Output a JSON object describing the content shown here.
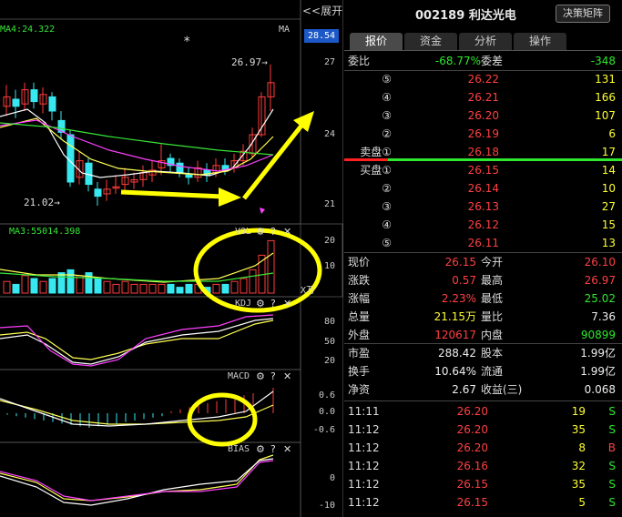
{
  "chart": {
    "expand_label": "<<展开",
    "ma_label": "MA4:24.322",
    "ma_right": "MA",
    "price_box": "28.54",
    "star": "*",
    "y_axis": [
      "27",
      "24",
      "21"
    ],
    "high_annotation": "26.97",
    "low_annotation": "21.02",
    "vol_ma": "MA3:55014.398",
    "vol_title": "VOL",
    "vol_axis": [
      "20",
      "10"
    ],
    "vol_unit": "X万",
    "kdj_title": "KDJ",
    "kdj_axis": [
      "80",
      "50",
      "20"
    ],
    "macd_title": "MACD",
    "macd_axis": [
      "0.6",
      "0.0",
      "-0.6"
    ],
    "bias_title": "BIAS",
    "bias_axis": [
      "0",
      "-10"
    ]
  },
  "header": {
    "code": "002189",
    "name": "利达光电",
    "decision_button": "决策矩阵"
  },
  "tabs": [
    "报价",
    "资金",
    "分析",
    "操作"
  ],
  "weibi": {
    "label": "委比",
    "value": "-68.77%",
    "diff_label": "委差",
    "diff_value": "-348"
  },
  "sell_orders": [
    {
      "label": "⑤",
      "price": "26.22",
      "volume": "131"
    },
    {
      "label": "④",
      "price": "26.21",
      "volume": "166"
    },
    {
      "label": "③",
      "price": "26.20",
      "volume": "107"
    },
    {
      "label": "②",
      "price": "26.19",
      "volume": "6"
    },
    {
      "label": "卖盘①",
      "price": "26.18",
      "volume": "17"
    }
  ],
  "buy_orders": [
    {
      "label": "买盘①",
      "price": "26.15",
      "volume": "14"
    },
    {
      "label": "②",
      "price": "26.14",
      "volume": "10"
    },
    {
      "label": "③",
      "price": "26.13",
      "volume": "27"
    },
    {
      "label": "④",
      "price": "26.12",
      "volume": "15"
    },
    {
      "label": "⑤",
      "price": "26.11",
      "volume": "13"
    }
  ],
  "stats": [
    {
      "l1": "现价",
      "v1": "26.15",
      "l2": "今开",
      "v2": "26.10"
    },
    {
      "l1": "涨跌",
      "v1": "0.57",
      "l2": "最高",
      "v2": "26.97"
    },
    {
      "l1": "涨幅",
      "v1": "2.23%",
      "l2": "最低",
      "v2": "25.02"
    },
    {
      "l1": "总量",
      "v1": "21.15万",
      "l2": "量比",
      "v2": "7.36"
    },
    {
      "l1": "外盘",
      "v1": "120617",
      "l2": "内盘",
      "v2": "90899"
    }
  ],
  "fundamentals": [
    {
      "l1": "市盈",
      "v1": "288.42",
      "l2": "股本",
      "v2": "1.99亿"
    },
    {
      "l1": "换手",
      "v1": "10.64%",
      "l2": "流通",
      "v2": "1.99亿"
    },
    {
      "l1": "净资",
      "v1": "2.67",
      "l2": "收益(三)",
      "v2": "0.068"
    }
  ],
  "trades": [
    {
      "time": "11:11",
      "price": "26.20",
      "volume": "19",
      "side": "S"
    },
    {
      "time": "11:12",
      "price": "26.20",
      "volume": "35",
      "side": "S"
    },
    {
      "time": "11:12",
      "price": "26.20",
      "volume": "8",
      "side": "B"
    },
    {
      "time": "11:12",
      "price": "26.16",
      "volume": "32",
      "side": "S"
    },
    {
      "time": "11:12",
      "price": "26.15",
      "volume": "35",
      "side": "S"
    },
    {
      "time": "11:12",
      "price": "26.15",
      "volume": "5",
      "side": "S"
    }
  ]
}
